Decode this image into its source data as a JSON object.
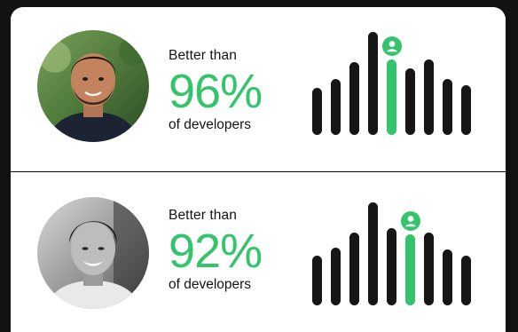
{
  "rankings": [
    {
      "lead": "Better than",
      "percent": "96%",
      "tail": "of developers",
      "bars": [
        44,
        52,
        68,
        96,
        70,
        62,
        70,
        52,
        46
      ],
      "highlight_index": 4,
      "colors": {
        "accent": "#34c46b",
        "bar": "#161616"
      }
    },
    {
      "lead": "Better than",
      "percent": "92%",
      "tail": "of developers",
      "bars": [
        46,
        54,
        68,
        96,
        72,
        66,
        68,
        52,
        46
      ],
      "highlight_index": 5,
      "colors": {
        "accent": "#34c46b",
        "bar": "#161616"
      }
    }
  ]
}
